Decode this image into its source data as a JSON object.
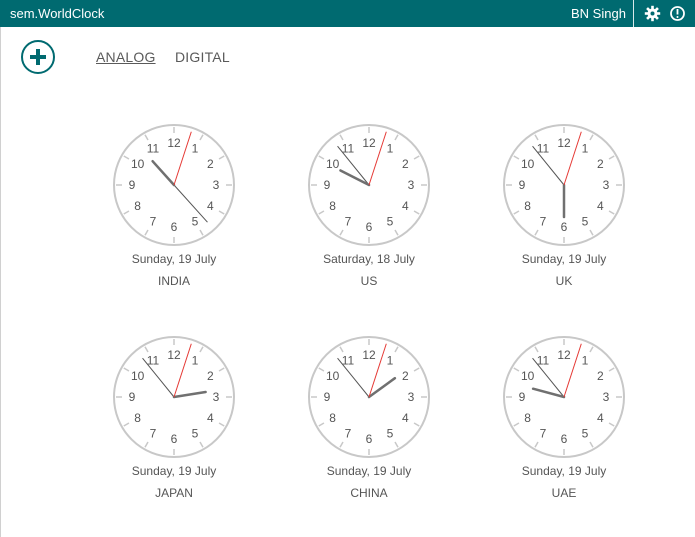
{
  "app": {
    "title": "sem.WorldClock",
    "user": "BN Singh",
    "icons": {
      "settings": "gear-icon",
      "power": "power-icon",
      "add": "add-icon"
    }
  },
  "tabs": [
    {
      "label": "ANALOG",
      "active": true
    },
    {
      "label": "DIGITAL",
      "active": false
    }
  ],
  "colors": {
    "accent": "#006a70",
    "second_hand": "#e53935",
    "hour_hand": "#707070",
    "face": "#c8c8c8"
  },
  "clock_numerals": [
    "12",
    "1",
    "2",
    "3",
    "4",
    "5",
    "6",
    "7",
    "8",
    "9",
    "10",
    "11"
  ],
  "clocks": [
    {
      "city": "INDIA",
      "date": "Sunday, 19 July",
      "hour": 10.6,
      "minute": 23.0,
      "second": 3
    },
    {
      "city": "US",
      "date": "Saturday, 18 July",
      "hour": 9.9,
      "minute": 53.5,
      "second": 3
    },
    {
      "city": "UK",
      "date": "Sunday, 19 July",
      "hour": 6.0,
      "minute": 53.5,
      "second": 3
    },
    {
      "city": "JAPAN",
      "date": "Sunday, 19 July",
      "hour": 2.7,
      "minute": 53.5,
      "second": 3
    },
    {
      "city": "CHINA",
      "date": "Sunday, 19 July",
      "hour": 1.8,
      "minute": 53.5,
      "second": 3
    },
    {
      "city": "UAE",
      "date": "Sunday, 19 July",
      "hour": 9.5,
      "minute": 53.5,
      "second": 3
    }
  ]
}
